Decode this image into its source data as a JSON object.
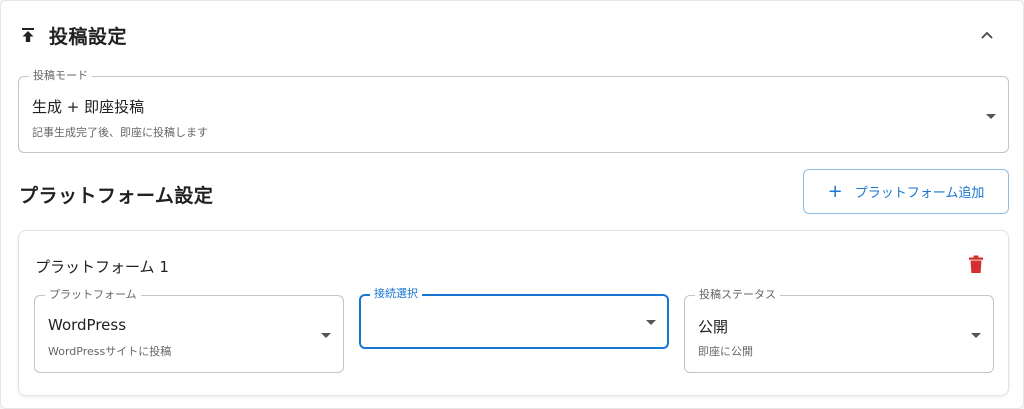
{
  "posting_section": {
    "title": "投稿設定",
    "icon": "upload-icon",
    "collapse_icon": "chevron-up-icon",
    "mode_field": {
      "label": "投稿モード",
      "value": "生成 + 即座投稿",
      "description": "記事生成完了後、即座に投稿します"
    }
  },
  "platform_section": {
    "title": "プラットフォーム設定",
    "add_button_label": "プラットフォーム追加",
    "cards": [
      {
        "title": "プラットフォーム 1",
        "platform_field": {
          "label": "プラットフォーム",
          "value": "WordPress",
          "description": "WordPressサイトに投稿"
        },
        "connection_field": {
          "label": "接続選択",
          "value": ""
        },
        "status_field": {
          "label": "投稿ステータス",
          "value": "公開",
          "description": "即座に公開"
        }
      }
    ]
  },
  "colors": {
    "accent": "#1976d2",
    "delete": "#d32f2f",
    "border": "#c4c4c4"
  }
}
